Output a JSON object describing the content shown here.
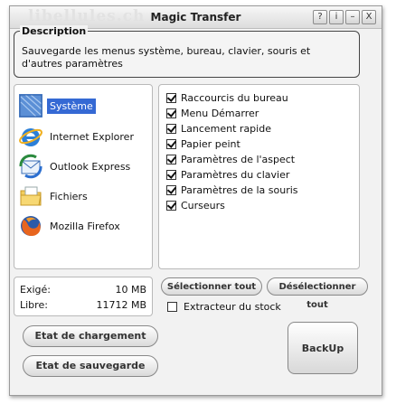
{
  "window": {
    "title": "Magic Transfer",
    "watermark": "libellules.ch"
  },
  "titlebar_buttons": [
    "?",
    "i",
    "–",
    "X"
  ],
  "description": {
    "legend": "Description",
    "text": "Sauvegarde les menus système, bureau, clavier, souris et d'autres paramètres"
  },
  "apps": [
    {
      "label": "Système",
      "icon": "windows-system-icon",
      "selected": true
    },
    {
      "label": "Internet Explorer",
      "icon": "internet-explorer-icon",
      "selected": false
    },
    {
      "label": "Outlook Express",
      "icon": "outlook-express-icon",
      "selected": false
    },
    {
      "label": "Fichiers",
      "icon": "folder-icon",
      "selected": false
    },
    {
      "label": "Mozilla Firefox",
      "icon": "firefox-icon",
      "selected": false
    }
  ],
  "options": [
    {
      "label": "Raccourcis du bureau",
      "checked": true
    },
    {
      "label": "Menu Démarrer",
      "checked": true
    },
    {
      "label": "Lancement rapide",
      "checked": true
    },
    {
      "label": "Papier peint",
      "checked": true
    },
    {
      "label": "Paramètres de l'aspect",
      "checked": true
    },
    {
      "label": "Paramètres du clavier",
      "checked": true
    },
    {
      "label": "Paramètres de la souris",
      "checked": true
    },
    {
      "label": "Curseurs",
      "checked": true
    }
  ],
  "stats": {
    "required_label": "Exigé:",
    "required_value": "10 MB",
    "free_label": "Libre:",
    "free_value": "11712 MB"
  },
  "buttons": {
    "select_all": "Sélectionner tout",
    "deselect_all": "Désélectionner tout",
    "load_state": "Etat de chargement",
    "save_state": "Etat de sauvegarde",
    "backup": "BackUp"
  },
  "stock_extractor": {
    "label": "Extracteur du stock",
    "checked": false
  },
  "colors": {
    "selection": "#3569d4",
    "window_bg": "#f2f2f2"
  }
}
